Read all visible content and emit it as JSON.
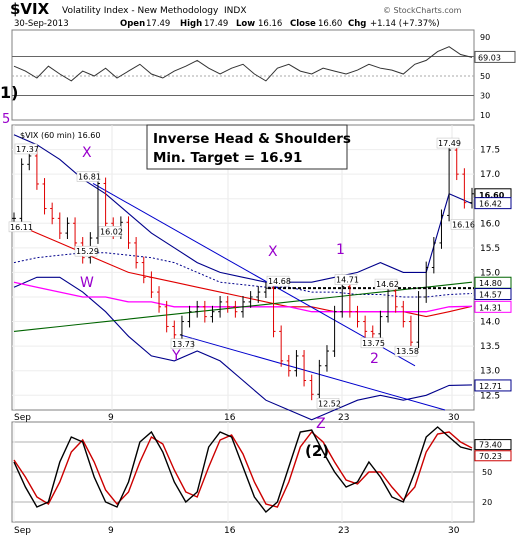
{
  "header": {
    "symbol": "$VIX",
    "name": "Volatility Index - New Methodology",
    "exchange": "INDX",
    "date": "30-Sep-2013",
    "open_label": "Open",
    "open": "17.49",
    "high_label": "High",
    "high": "17.49",
    "low_label": "Low",
    "low": "16.16",
    "close_label": "Close",
    "close": "16.60",
    "chg_label": "Chg",
    "chg": "+1.14 (+7.37%)",
    "watermark": "© StockCharts.com"
  },
  "price_panel": {
    "legend": "$VIX (60 min) 16.60",
    "annotation_line1": "Inverse Head & Shoulders",
    "annotation_line2": "Min. Target = 16.91",
    "wave_labels": [
      "1)",
      "5",
      "X",
      "W",
      "Y",
      "X",
      "1",
      "2",
      "Z",
      "(2)"
    ]
  },
  "colors": {
    "price": "#000000",
    "up_bar": "#00a000",
    "down_bar": "#e00000",
    "bollinger": "#00008b",
    "sma_red": "#e00000",
    "sma_green": "#006400",
    "sma_magenta": "#ff00ff",
    "trendline": "#0000cc",
    "wave_label": "#9900cc",
    "rsi": "#333333",
    "slow_k": "#000000",
    "slow_d": "#cc0000"
  },
  "chart_data": [
    {
      "type": "line",
      "panel": "rsi",
      "yticks": [
        90,
        70,
        50,
        30,
        10
      ],
      "last_value": "69.03",
      "x": [
        "Sep",
        "9",
        "16",
        "23",
        "30"
      ],
      "values": [
        60,
        55,
        48,
        60,
        52,
        45,
        55,
        50,
        58,
        48,
        55,
        62,
        52,
        48,
        55,
        60,
        66,
        58,
        52,
        58,
        62,
        52,
        45,
        58,
        62,
        55,
        52,
        58,
        55,
        52,
        56,
        62,
        58,
        56,
        52,
        62,
        66,
        75,
        80,
        72,
        69
      ]
    },
    {
      "type": "line",
      "panel": "price",
      "title": "$VIX (60 min)",
      "ylim": [
        12.2,
        18.0
      ],
      "yticks": [
        "17.5",
        "17.0",
        "16.5",
        "16.0",
        "15.5",
        "15.0",
        "14.5",
        "14.0",
        "13.5",
        "13.0",
        "12.5"
      ],
      "xticks": [
        "Sep",
        "9",
        "16",
        "23",
        "30"
      ],
      "right_labels": [
        "16.60",
        "16.42",
        "14.80",
        "14.57",
        "14.31",
        "12.71"
      ],
      "point_labels": [
        "17.37",
        "16.11",
        "16.81",
        "16.02",
        "15.29",
        "13.73",
        "14.68",
        "12.52",
        "14.71",
        "13.75",
        "14.62",
        "13.58",
        "17.49",
        "16.16"
      ],
      "close": [
        16.1,
        17.2,
        17.37,
        16.8,
        16.3,
        16.1,
        15.8,
        16.0,
        15.6,
        15.3,
        15.7,
        16.81,
        16.0,
        15.8,
        16.02,
        15.6,
        15.2,
        14.9,
        14.6,
        14.3,
        13.9,
        13.73,
        14.0,
        14.2,
        14.3,
        14.1,
        14.2,
        14.4,
        14.3,
        14.2,
        14.4,
        14.5,
        14.6,
        14.68,
        13.8,
        13.2,
        13.0,
        13.3,
        12.8,
        12.52,
        13.1,
        13.4,
        14.2,
        14.71,
        14.2,
        14.0,
        13.8,
        13.75,
        14.1,
        14.62,
        14.3,
        14.0,
        13.58,
        14.5,
        15.1,
        15.6,
        16.16,
        17.49,
        17.0,
        16.42,
        16.6
      ],
      "bollinger_upper": [
        17.8,
        17.6,
        17.3,
        16.9,
        16.6,
        16.2,
        15.8,
        15.5,
        15.2,
        15.0,
        14.9,
        14.8,
        14.8,
        14.8,
        14.9,
        15.0,
        15.2,
        15.0,
        15.0,
        16.6,
        16.4
      ],
      "bollinger_lower": [
        14.7,
        14.9,
        14.9,
        14.6,
        14.2,
        13.7,
        13.3,
        13.2,
        13.4,
        13.2,
        12.8,
        12.4,
        12.2,
        12.0,
        12.2,
        12.4,
        12.5,
        12.4,
        12.5,
        12.7,
        12.71
      ],
      "sma_red": [
        16.0,
        15.8,
        15.6,
        15.4,
        15.2,
        15.0,
        14.9,
        14.8,
        14.7,
        14.6,
        14.5,
        14.4,
        14.3,
        14.3,
        14.2,
        14.2,
        14.2,
        14.2,
        14.1,
        14.2,
        14.31
      ],
      "sma_green": [
        13.8,
        13.85,
        13.9,
        13.95,
        14.0,
        14.05,
        14.1,
        14.15,
        14.2,
        14.25,
        14.3,
        14.35,
        14.4,
        14.45,
        14.5,
        14.55,
        14.6,
        14.65,
        14.7,
        14.75,
        14.8
      ],
      "sma_magenta": [
        14.8,
        14.7,
        14.6,
        14.5,
        14.5,
        14.4,
        14.4,
        14.3,
        14.3,
        14.3,
        14.3,
        14.3,
        14.3,
        14.2,
        14.2,
        14.2,
        14.2,
        14.2,
        14.2,
        14.3,
        14.31
      ],
      "sma_dotted": [
        15.2,
        15.3,
        15.35,
        15.4,
        15.4,
        15.35,
        15.3,
        15.2,
        15.0,
        14.8,
        14.75,
        14.7,
        14.7,
        14.6,
        14.6,
        14.55,
        14.55,
        14.5,
        14.5,
        14.55,
        14.57
      ]
    },
    {
      "type": "line",
      "panel": "slow_stochastic",
      "yticks": [
        80,
        50,
        20
      ],
      "right_labels": [
        "73.40",
        "70.23"
      ],
      "k": [
        60,
        35,
        15,
        20,
        60,
        85,
        80,
        45,
        20,
        15,
        40,
        80,
        90,
        70,
        40,
        20,
        30,
        75,
        90,
        85,
        55,
        25,
        10,
        20,
        55,
        90,
        92,
        70,
        50,
        35,
        40,
        60,
        45,
        25,
        20,
        50,
        85,
        95,
        85,
        75,
        72
      ],
      "d": [
        62,
        45,
        25,
        18,
        40,
        70,
        82,
        60,
        32,
        18,
        30,
        60,
        85,
        78,
        52,
        30,
        25,
        55,
        82,
        87,
        68,
        40,
        18,
        15,
        40,
        75,
        90,
        80,
        60,
        42,
        38,
        50,
        50,
        35,
        22,
        35,
        70,
        88,
        90,
        80,
        74
      ]
    }
  ]
}
